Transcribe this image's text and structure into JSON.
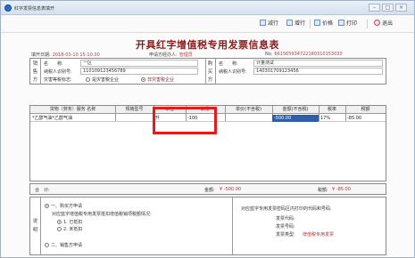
{
  "window": {
    "title": "红字发票信息表填开",
    "btn_min": "–",
    "btn_max": "□",
    "btn_close": "×"
  },
  "toolbar": {
    "delete_row": "减行",
    "add_row": "增行",
    "price": "价格",
    "print": "打印",
    "exit": "退出"
  },
  "form": {
    "title": "开具红字增值税专用发票信息表",
    "fill_date_label": "填开日期:",
    "fill_date": "2018-03-10 15:10:30",
    "applicant_label": "申请方经办人:",
    "applicant": "管理员",
    "no_label": "No.",
    "no": "661565934722180310153030"
  },
  "seller": {
    "side": [
      "销",
      "售",
      "方"
    ],
    "name_label": "名　　称:",
    "name": "一区",
    "taxid_label": "纳税人识别号:",
    "taxid": "110109123456789",
    "doc_label": "灾害等税标志:",
    "opt1": "是灾害税企业",
    "opt2": "非灾害税企业"
  },
  "buyer": {
    "side": [
      "购",
      "买",
      "方"
    ],
    "name_label": "名　　称:",
    "name": "计量测试",
    "taxid_label": "纳税人识别号:",
    "taxid": "140301709123456"
  },
  "table": {
    "headers": [
      "货物（劳务）服务 名称",
      "规格型号",
      "单位",
      "数量",
      "单价(不含税)",
      "金额(不含税)",
      "税率",
      "税额"
    ],
    "rows": [
      {
        "name": "*乙醇气油*乙醇气油",
        "spec": "",
        "unit": "升",
        "qty": "-100",
        "price": "",
        "amount": "-500.00",
        "rate": "17%",
        "tax": "-85.00"
      }
    ]
  },
  "totals": {
    "label": "合　计:",
    "amount_label": "金额:",
    "amount": "¥ -500.00",
    "tax_label": "税额:",
    "tax": "¥ -85.00"
  },
  "notes": {
    "side": [
      "说",
      "明"
    ],
    "opt_buyer": "一、购买方申请",
    "question": "对应蓝字增值税专用发票抵扣增值税销项税额情况:",
    "sub1": "1. 已抵扣",
    "sub2": "2. 未抵扣",
    "opt_seller": "二、销售方申请",
    "right_title": "对应蓝字专用发票密码区内打印的代码和号码:",
    "code_label": "发票代码:",
    "number_label": "发票号码:",
    "type_label": "发票类型:",
    "type_value": "增值税专用发票"
  }
}
